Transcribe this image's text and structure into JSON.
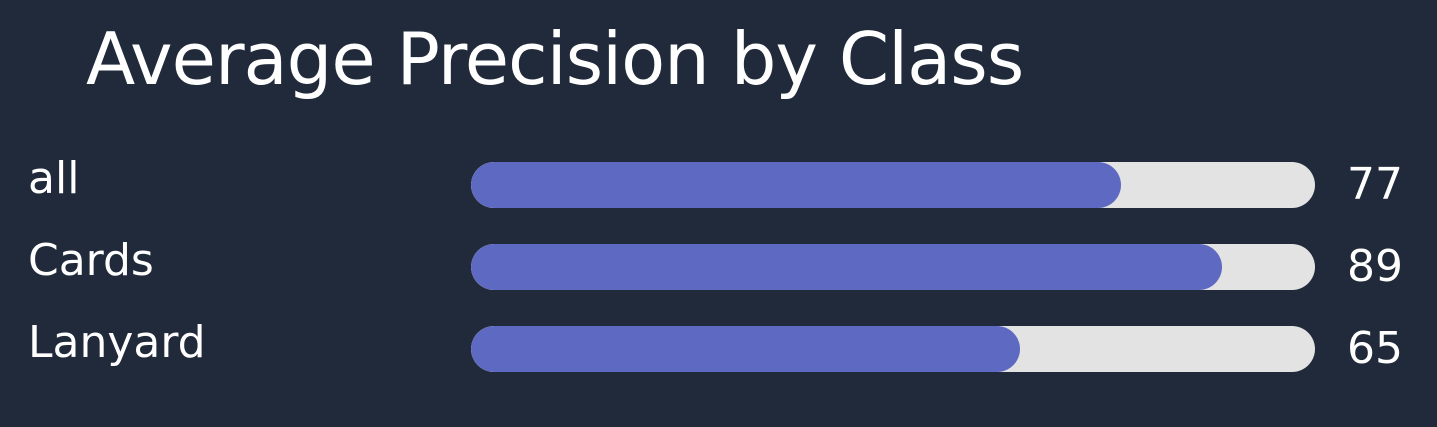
{
  "chart_data": {
    "type": "bar",
    "orientation": "horizontal",
    "title": "Average Precision by Class",
    "categories": [
      "all",
      "Cards",
      "Lanyard"
    ],
    "values": [
      77,
      89,
      65
    ],
    "value_labels": [
      "77",
      "89",
      "65"
    ],
    "xlim": [
      0,
      100
    ],
    "grid": false,
    "legend": "none",
    "colors": {
      "background": "#212a3a",
      "bar_fill": "#5e6ac2",
      "bar_track": "#e3e3e3",
      "text": "#ffffff"
    }
  }
}
